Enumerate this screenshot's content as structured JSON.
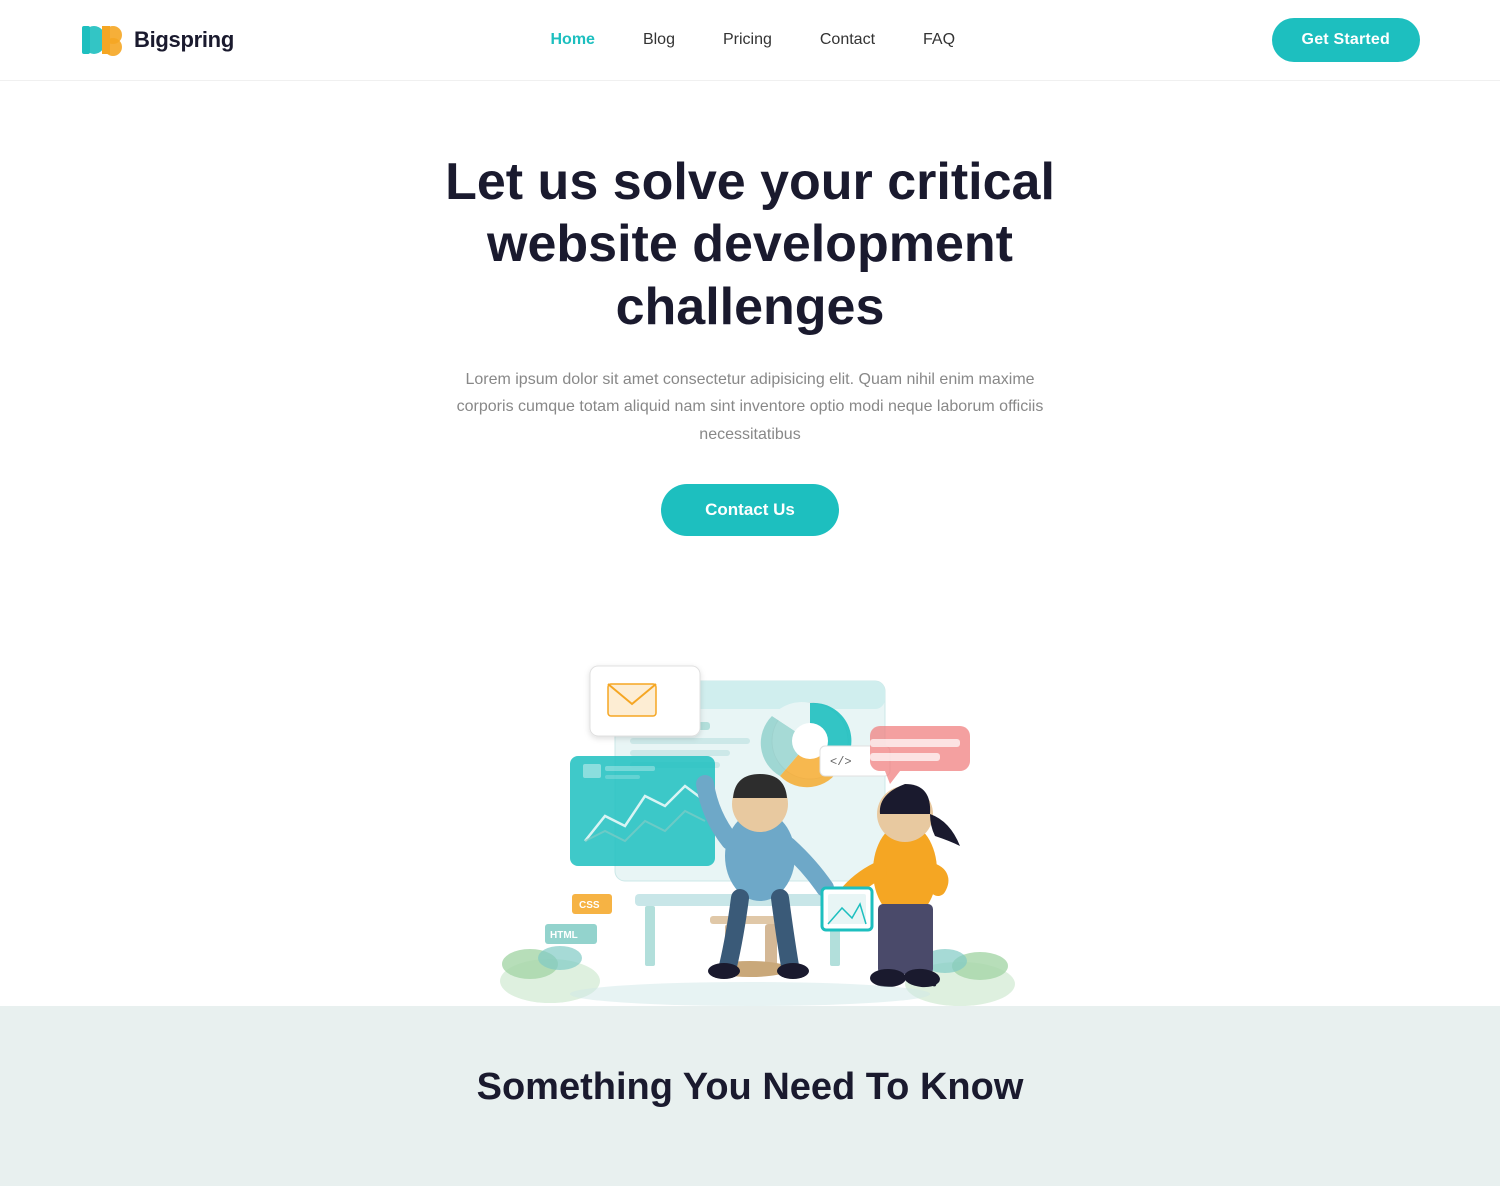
{
  "header": {
    "logo_text": "Bigspring",
    "nav": {
      "items": [
        {
          "label": "Home",
          "active": true
        },
        {
          "label": "Blog",
          "active": false
        },
        {
          "label": "Pricing",
          "active": false
        },
        {
          "label": "Contact",
          "active": false
        },
        {
          "label": "FAQ",
          "active": false
        }
      ]
    },
    "cta_button": "Get Started"
  },
  "hero": {
    "title": "Let us solve your critical website development challenges",
    "description": "Lorem ipsum dolor sit amet consectetur adipisicing elit. Quam nihil enim maxime corporis cumque totam aliquid nam sint inventore optio modi neque laborum officiis necessitatibus",
    "contact_button": "Contact Us"
  },
  "bottom": {
    "title": "Something You Need To Know"
  }
}
